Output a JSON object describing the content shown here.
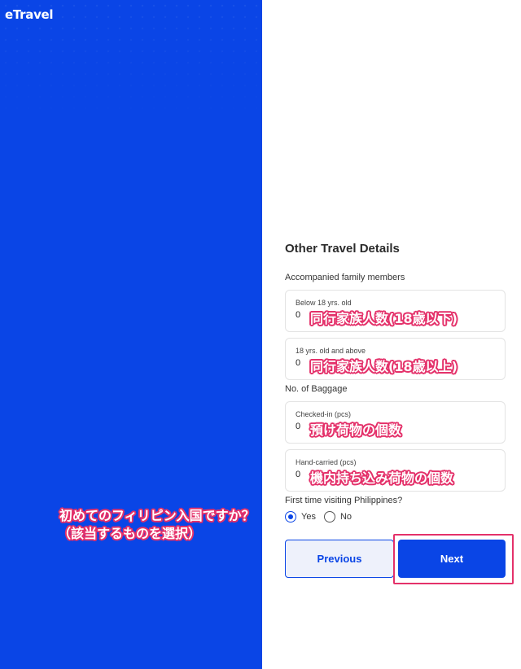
{
  "brand": {
    "logo_text": "eTravel",
    "primary_color": "#0a45e6",
    "annotation_color": "#e4316a"
  },
  "left_annotation": {
    "line1": "初めてのフィリピン入国ですか？",
    "line2": "（該当するものを選択）"
  },
  "form": {
    "title": "Other Travel Details",
    "family_group_label": "Accompanied family members",
    "below18": {
      "label": "Below 18 yrs. old",
      "value": "0",
      "annotation": "同行家族人数(18歳以下)"
    },
    "above18": {
      "label": "18 yrs. old and above",
      "value": "0",
      "annotation": "同行家族人数(18歳以上)"
    },
    "baggage_group_label": "No. of Baggage",
    "checked_in": {
      "label": "Checked-in (pcs)",
      "value": "0",
      "annotation": "預け荷物の個数"
    },
    "hand_carried": {
      "label": "Hand-carried (pcs)",
      "value": "0",
      "annotation": "機内持ち込み荷物の個数"
    },
    "first_time_question": "First time visiting Philippines?",
    "first_time_options": {
      "yes": "Yes",
      "no": "No",
      "selected": "Yes"
    }
  },
  "buttons": {
    "previous": "Previous",
    "next": "Next"
  }
}
